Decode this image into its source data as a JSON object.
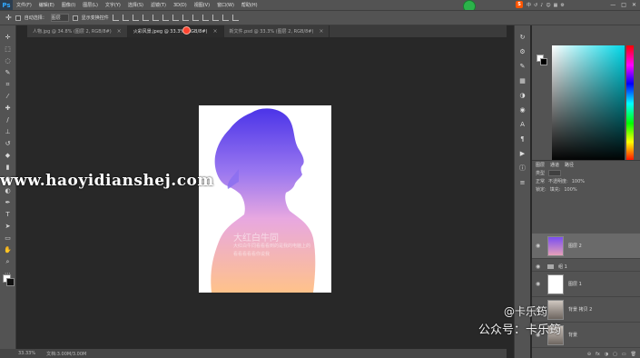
{
  "menubar": {
    "logo": "Ps",
    "items": [
      "文件(F)",
      "编辑(E)",
      "图像(I)",
      "图层(L)",
      "文字(Y)",
      "选择(S)",
      "滤镜(T)",
      "3D(D)",
      "视图(V)",
      "窗口(W)",
      "帮助(H)"
    ],
    "tray_icons": [
      "中",
      "↺",
      "♪",
      "☺",
      "▦",
      "⚙"
    ],
    "window_controls": [
      "—",
      "□",
      "✕"
    ]
  },
  "options": {
    "tool_icon": "move-icon",
    "auto_select_label": "自动选择：",
    "auto_select_value": "图层",
    "transform_label": "显示变换控件"
  },
  "tabs": [
    {
      "label": "人物.jpg @ 34.8% (图层 2, RGB/8#)",
      "active": false
    },
    {
      "label": "火彩风景.jpeg @ 33.3% (RGB/8#)",
      "active": true
    },
    {
      "label": "新文件.psd @ 33.3% (图层 2, RGB/8#)",
      "active": false
    }
  ],
  "poster": {
    "title_line": "大红白牛同",
    "sub_line_1": "大红白牛同看看看到的是我的电脑上的",
    "sub_line_2": "看看看看看你说我"
  },
  "overlay_watermark": "www.haoyidianshej.com",
  "statusbar": {
    "zoom": "33.33%",
    "doc_info": "文档:3.00M/3.00M"
  },
  "colors": {
    "ui_bg": "#535353",
    "canvas_bg": "#282828",
    "silhouette_top": "#5a3ff0",
    "silhouette_bottom": "#ffb88a",
    "picker_hue": "#00d8e8"
  },
  "layers_panel": {
    "tabs": [
      "图层",
      "通道",
      "路径"
    ],
    "kind_label": "类型",
    "blend_mode": "正常",
    "opacity_label": "不透明度:",
    "opacity_value": "100%",
    "lock_label": "锁定:",
    "fill_label": "填充:",
    "fill_value": "100%",
    "layers": [
      {
        "name": "图层 2",
        "selected": true
      },
      {
        "name": "组 1",
        "group": true
      },
      {
        "name": "图层 1",
        "selected": false
      },
      {
        "name": "背景 拷贝 2",
        "selected": false
      },
      {
        "name": "背景",
        "selected": false
      }
    ],
    "bottom_icons": [
      "⊖",
      "fx",
      "◑",
      "▢",
      "▭",
      "🗑"
    ]
  },
  "account_watermark": {
    "line1": "@卡乐筠",
    "line2": "公众号：卡乐筠"
  }
}
